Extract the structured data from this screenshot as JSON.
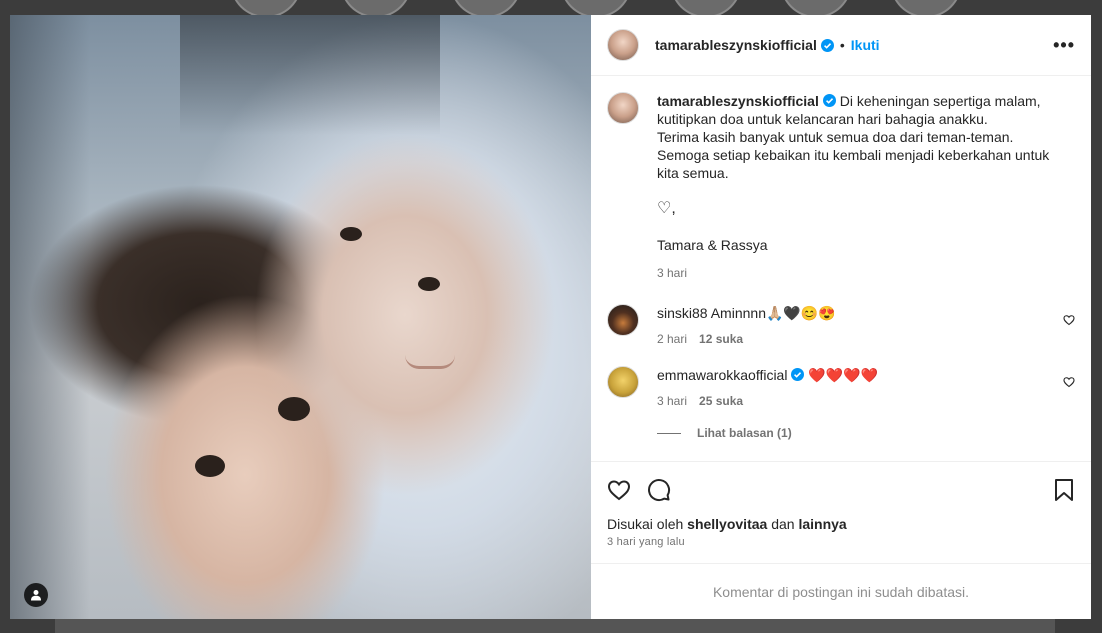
{
  "post": {
    "author": "tamarableszynskiofficial",
    "follow_label": "Ikuti",
    "dot": "•",
    "more_label": "•••"
  },
  "caption": {
    "username": "tamarableszynskiofficial",
    "text": "Di keheningan sepertiga malam,\nkutitipkan doa untuk kelancaran hari bahagia anakku.\nTerima kasih banyak untuk semua doa dari teman-teman.\nSemoga setiap kebaikan itu kembali menjadi keberkahan untuk\nkita semua.",
    "heart_line": "♡,",
    "signature": "Tamara & Rassya",
    "time": "3 hari"
  },
  "comments": [
    {
      "username": "sinski88",
      "text": "Aminnnn🙏🏼🖤😊😍",
      "time": "2 hari",
      "likes": "12 suka"
    },
    {
      "username": "emmawarokkaofficial",
      "text": "❤️❤️❤️❤️",
      "time": "3 hari",
      "likes": "25 suka",
      "replies_label": "Lihat balasan (1)"
    }
  ],
  "likes": {
    "prefix": "Disukai oleh",
    "user": "shellyovitaa",
    "middle": "dan",
    "others": "lainnya"
  },
  "post_time": "3 hari yang lalu",
  "comments_limited": "Komentar di postingan ini sudah dibatasi.",
  "colors": {
    "accent": "#0095f6",
    "verified": "#0095f6",
    "muted": "#737373"
  },
  "icons": [
    "verified-badge-icon",
    "more-options-icon",
    "heart-icon",
    "comment-icon",
    "save-bookmark-icon",
    "user-tag-icon"
  ]
}
